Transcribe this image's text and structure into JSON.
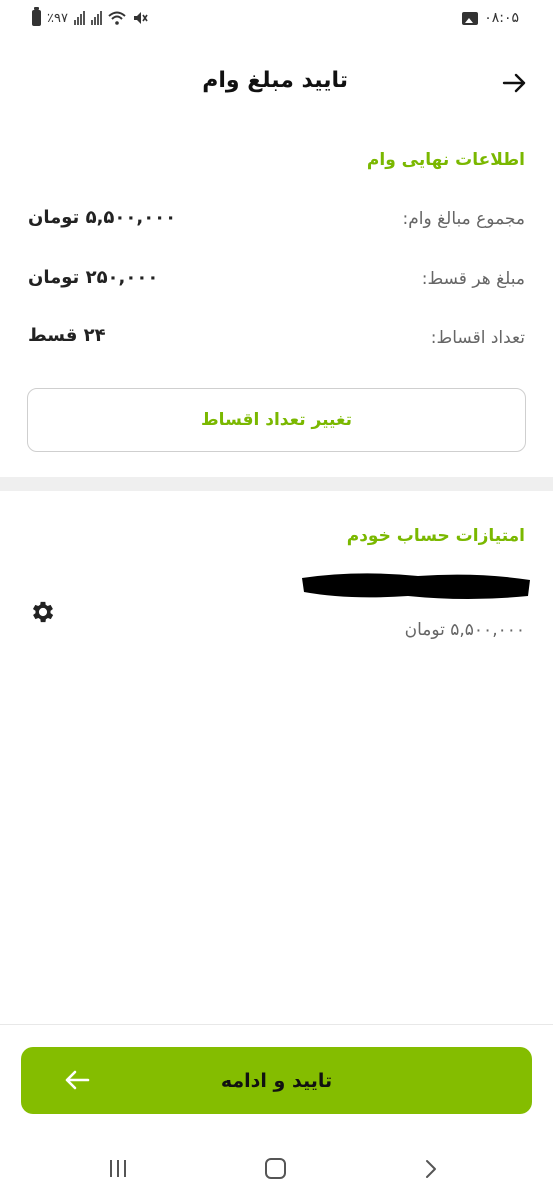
{
  "status_bar": {
    "battery_percent": "٪۹۷",
    "time": "۰۸:۰۵",
    "icons": [
      "battery-icon",
      "signal-icon",
      "signal-icon",
      "wifi-icon",
      "mute-icon",
      "gallery-icon"
    ]
  },
  "header": {
    "title": "تایید مبلغ وام",
    "back_icon": "arrow-right-icon"
  },
  "loan_info": {
    "section_title": "اطلاعات نهایی وام",
    "rows": [
      {
        "label": "مجموع مبالغ وام:",
        "value": "۵,۵۰۰,۰۰۰ تومان"
      },
      {
        "label": "مبلغ هر قسط:",
        "value": "۲۵۰,۰۰۰ تومان"
      },
      {
        "label": "تعداد اقساط:",
        "value": "۲۴ قسط"
      }
    ],
    "change_button_label": "تغییر تعداد اقساط"
  },
  "account": {
    "section_title": "امتیازات حساب خودم",
    "balance": "۵,۵۰۰,۰۰۰ تومان",
    "settings_icon": "gear-icon"
  },
  "footer": {
    "confirm_label": "تایید و ادامه",
    "confirm_icon": "arrow-left-icon"
  },
  "colors": {
    "accent_green": "#7ab800",
    "button_green": "#84bd00"
  }
}
